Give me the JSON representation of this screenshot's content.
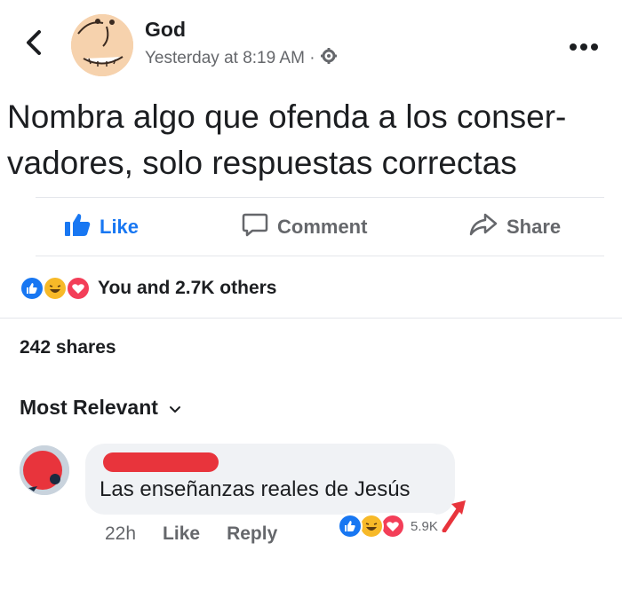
{
  "post": {
    "author": "God",
    "timestamp": "Yesterday at 8:19 AM ·",
    "privacy_icon": "gear-icon",
    "text_lines": [
      "Nombra algo que ofenda a los conser-",
      "vadores, solo respuestas correctas"
    ]
  },
  "actions": {
    "like": "Like",
    "comment": "Comment",
    "share": "Share"
  },
  "reactions": {
    "summary": "You and 2.7K others",
    "types": [
      "like",
      "haha",
      "love"
    ]
  },
  "shares": "242 shares",
  "sort": {
    "label": "Most Relevant"
  },
  "comment": {
    "text": "Las enseñanzas reales de Jesús",
    "time": "22h",
    "like": "Like",
    "reply": "Reply",
    "reaction_count": "5.9K"
  },
  "colors": {
    "facebook_blue": "#1877f2",
    "secondary_text": "#65676b",
    "divider": "#e4e6eb",
    "bubble": "#f0f2f5",
    "love_red": "#f33e58",
    "haha_yellow": "#f7b928"
  }
}
